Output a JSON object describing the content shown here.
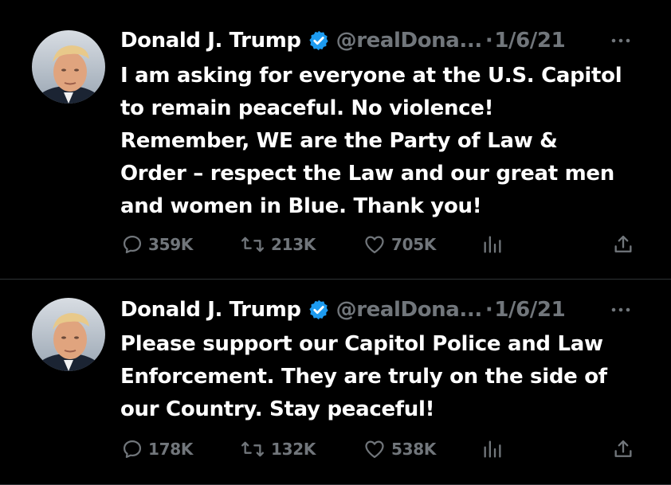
{
  "tweets": [
    {
      "author_name": "Donald J. Trump",
      "handle": "@realDona...",
      "separator": "·",
      "date": "1/6/21",
      "body_lines": [
        "I am asking for everyone at the U.S. Capitol",
        "to remain peaceful. No violence!",
        "Remember, WE are the Party of Law &",
        "Order – respect the Law and our great men",
        "and women in Blue. Thank you!"
      ],
      "replies": "359K",
      "retweets": "213K",
      "likes": "705K",
      "verified_icon": "verified-badge-icon",
      "more_icon": "more-options-icon"
    },
    {
      "author_name": "Donald J. Trump",
      "handle": "@realDona...",
      "separator": "·",
      "date": "1/6/21",
      "body_lines": [
        "Please support our Capitol Police and Law",
        "Enforcement. They are truly on the side of",
        "our Country. Stay peaceful!"
      ],
      "replies": "178K",
      "retweets": "132K",
      "likes": "538K",
      "verified_icon": "verified-badge-icon",
      "more_icon": "more-options-icon"
    }
  ],
  "icons": {
    "reply": "reply-icon",
    "retweet": "retweet-icon",
    "like": "heart-icon",
    "views": "views-icon",
    "share": "share-icon"
  },
  "colors": {
    "background": "#000000",
    "text_primary": "#ffffff",
    "text_secondary": "#71767b",
    "verified_blue": "#1d9bf0",
    "divider": "#2f3336"
  }
}
